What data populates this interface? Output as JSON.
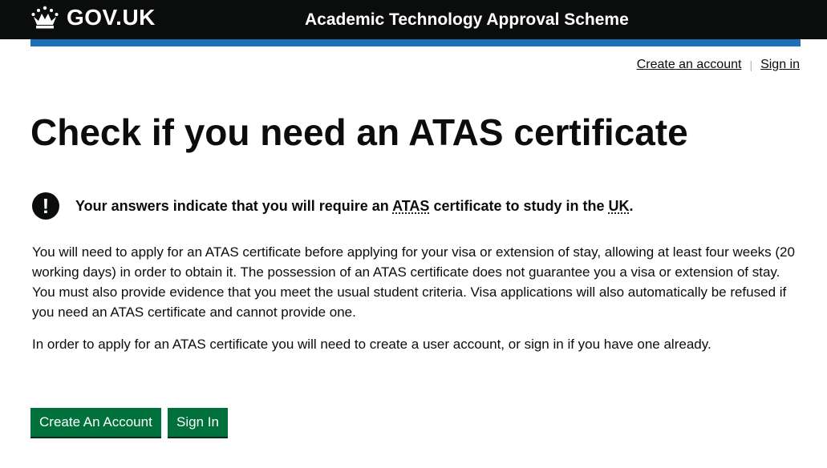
{
  "header": {
    "logo_text": "GOV.UK",
    "service_name": "Academic Technology Approval Scheme"
  },
  "account_nav": {
    "create_account": "Create an account",
    "separator": "|",
    "sign_in": "Sign in"
  },
  "main": {
    "title": "Check if you need an ATAS certificate",
    "warning": {
      "icon": "!",
      "text_before": "Your answers indicate that you will require an ",
      "abbr_atas": "ATAS",
      "text_middle": " certificate to study in the ",
      "abbr_uk": "UK",
      "text_after": "."
    },
    "paragraph_1": "You will need to apply for an ATAS certificate before applying for your visa or extension of stay, allowing at least four weeks (20 working days) in order to obtain it. The possession of an ATAS certificate does not guarantee you a visa or extension of stay. You must also provide evidence that you meet the usual student criteria. Visa applications will also automatically be refused if you need an ATAS certificate and cannot provide one.",
    "paragraph_2": "In order to apply for an ATAS certificate you will need to create a user account, or sign in if you have one already.",
    "buttons": {
      "create_account": "Create An Account",
      "sign_in": "Sign In"
    }
  },
  "colors": {
    "header_bg": "#0b0c0c",
    "accent_bar": "#1d70b8",
    "button_green": "#00703c"
  }
}
